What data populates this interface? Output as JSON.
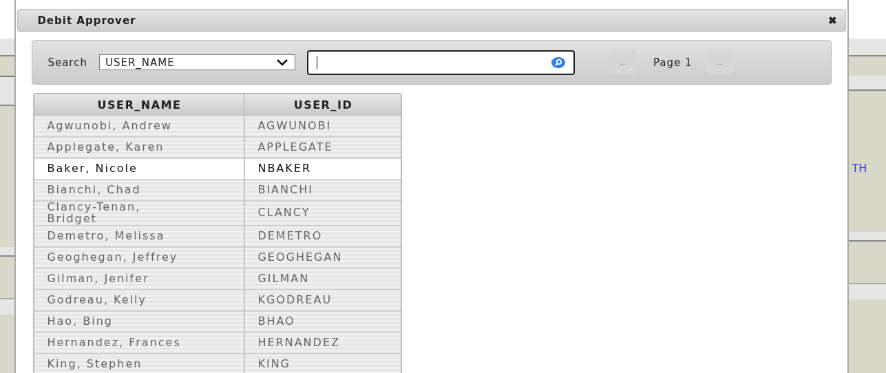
{
  "background": {
    "right_text": "TH"
  },
  "dialog": {
    "title": "Debit Approver",
    "close": "✖"
  },
  "search": {
    "label": "Search",
    "field_choice": "USER_NAME"
  },
  "pager": {
    "prev": "←",
    "page": "Page 1",
    "next": "→"
  },
  "table": {
    "columns": [
      "USER_NAME",
      "USER_ID"
    ],
    "rows": [
      {
        "cells": [
          "Agwunobi, Andrew",
          "AGWUNOBI"
        ],
        "selected": false
      },
      {
        "cells": [
          "Applegate, Karen",
          "APPLEGATE"
        ],
        "selected": false
      },
      {
        "cells": [
          "Baker, Nicole",
          "NBAKER"
        ],
        "selected": true
      },
      {
        "cells": [
          "Bianchi, Chad",
          "BIANCHI"
        ],
        "selected": false
      },
      {
        "cells": [
          "Clancy-Tenan, Bridget",
          "CLANCY"
        ],
        "selected": false
      },
      {
        "cells": [
          "Demetro, Melissa",
          "DEMETRO"
        ],
        "selected": false
      },
      {
        "cells": [
          "Geoghegan, Jeffrey",
          "GEOGHEGAN"
        ],
        "selected": false
      },
      {
        "cells": [
          "Gilman, Jenifer",
          "GILMAN"
        ],
        "selected": false
      },
      {
        "cells": [
          "Godreau, Kelly",
          "KGODREAU"
        ],
        "selected": false
      },
      {
        "cells": [
          "Hao, Bing",
          "BHAO"
        ],
        "selected": false
      },
      {
        "cells": [
          "Hernandez, Frances",
          "HERNANDEZ"
        ],
        "selected": false
      },
      {
        "cells": [
          "King, Stephen",
          "KING"
        ],
        "selected": false
      }
    ]
  }
}
